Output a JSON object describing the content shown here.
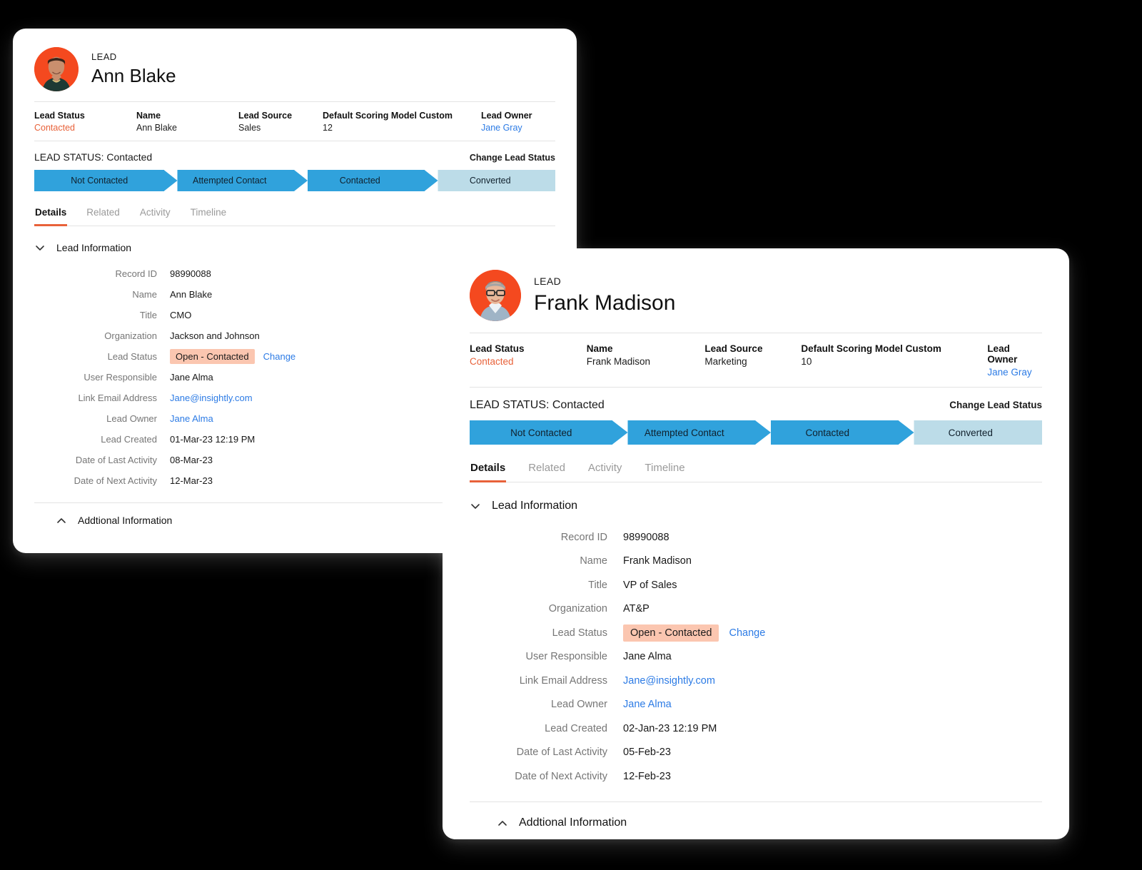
{
  "cards": [
    {
      "id": "ann",
      "record_kind": "LEAD",
      "record_name": "Ann Blake",
      "avatar_icon": "woman-avatar",
      "summary": [
        {
          "label": "Lead Status",
          "value": "Contacted",
          "style": "accent"
        },
        {
          "label": "Name",
          "value": "Ann Blake",
          "style": "plain"
        },
        {
          "label": "Lead Source",
          "value": "Sales",
          "style": "plain"
        },
        {
          "label": "Default Scoring Model Custom",
          "value": "12",
          "style": "plain"
        },
        {
          "label": "Lead Owner",
          "value": "Jane Gray",
          "style": "link"
        }
      ],
      "status_title": "LEAD STATUS: Contacted",
      "status_change_label": "Change Lead Status",
      "path_steps": [
        {
          "label": "Not Contacted",
          "state": "done"
        },
        {
          "label": "Attempted Contact",
          "state": "done"
        },
        {
          "label": "Contacted",
          "state": "done"
        },
        {
          "label": "Converted",
          "state": "future"
        }
      ],
      "tabs": [
        {
          "label": "Details",
          "active": true
        },
        {
          "label": "Related",
          "active": false
        },
        {
          "label": "Activity",
          "active": false
        },
        {
          "label": "Timeline",
          "active": false
        }
      ],
      "section_title": "Lead Information",
      "section_expanded": true,
      "fields": [
        {
          "label": "Record ID",
          "value": "98990088",
          "style": "plain"
        },
        {
          "label": "Name",
          "value": "Ann Blake",
          "style": "plain"
        },
        {
          "label": "Title",
          "value": "CMO",
          "style": "plain"
        },
        {
          "label": "Organization",
          "value": "Jackson and Johnson",
          "style": "plain"
        },
        {
          "label": "Lead Status",
          "value": "Open - Contacted",
          "style": "badge",
          "action_label": "Change"
        },
        {
          "label": "User Responsible",
          "value": "Jane Alma",
          "style": "plain"
        },
        {
          "label": "Link Email Address",
          "value": "Jane@insightly.com",
          "style": "link"
        },
        {
          "label": "Lead Owner",
          "value": "Jane Alma",
          "style": "link"
        },
        {
          "label": "Lead Created",
          "value": "01-Mar-23 12:19 PM",
          "style": "plain"
        },
        {
          "label": "Date of Last Activity",
          "value": "08-Mar-23",
          "style": "plain"
        },
        {
          "label": "Date of Next Activity",
          "value": "12-Mar-23",
          "style": "plain"
        }
      ],
      "footer_section_title": "Addtional Information",
      "footer_section_expanded": false
    },
    {
      "id": "frank",
      "record_kind": "LEAD",
      "record_name": "Frank Madison",
      "avatar_icon": "man-glasses-avatar",
      "summary": [
        {
          "label": "Lead Status",
          "value": "Contacted",
          "style": "accent"
        },
        {
          "label": "Name",
          "value": "Frank Madison",
          "style": "plain"
        },
        {
          "label": "Lead Source",
          "value": "Marketing",
          "style": "plain"
        },
        {
          "label": "Default Scoring Model Custom",
          "value": "10",
          "style": "plain"
        },
        {
          "label": "Lead Owner",
          "value": "Jane Gray",
          "style": "link"
        }
      ],
      "status_title": "LEAD STATUS: Contacted",
      "status_change_label": "Change Lead Status",
      "path_steps": [
        {
          "label": "Not Contacted",
          "state": "done"
        },
        {
          "label": "Attempted Contact",
          "state": "done"
        },
        {
          "label": "Contacted",
          "state": "done"
        },
        {
          "label": "Converted",
          "state": "future"
        }
      ],
      "tabs": [
        {
          "label": "Details",
          "active": true
        },
        {
          "label": "Related",
          "active": false
        },
        {
          "label": "Activity",
          "active": false
        },
        {
          "label": "Timeline",
          "active": false
        }
      ],
      "section_title": "Lead Information",
      "section_expanded": true,
      "fields": [
        {
          "label": "Record ID",
          "value": "98990088",
          "style": "plain"
        },
        {
          "label": "Name",
          "value": "Frank Madison",
          "style": "plain"
        },
        {
          "label": "Title",
          "value": "VP of Sales",
          "style": "plain"
        },
        {
          "label": "Organization",
          "value": "AT&P",
          "style": "plain"
        },
        {
          "label": "Lead Status",
          "value": "Open - Contacted",
          "style": "badge",
          "action_label": "Change"
        },
        {
          "label": "User Responsible",
          "value": "Jane Alma",
          "style": "plain"
        },
        {
          "label": "Link Email Address",
          "value": "Jane@insightly.com",
          "style": "link"
        },
        {
          "label": "Lead Owner",
          "value": "Jane Alma",
          "style": "link"
        },
        {
          "label": "Lead Created",
          "value": "02-Jan-23 12:19 PM",
          "style": "plain"
        },
        {
          "label": "Date of Last Activity",
          "value": "05-Feb-23",
          "style": "plain"
        },
        {
          "label": "Date of Next Activity",
          "value": "12-Feb-23",
          "style": "plain"
        }
      ],
      "footer_section_title": "Addtional Information",
      "footer_section_expanded": false
    }
  ],
  "colors": {
    "accent_orange": "#E8623A",
    "link_blue": "#2C7BE5",
    "path_active": "#30A2DC",
    "path_future": "#BCDCE8",
    "badge_bg": "#FBC6B0",
    "avatar_bg": "#F4491F",
    "page_bg": "#000000"
  }
}
